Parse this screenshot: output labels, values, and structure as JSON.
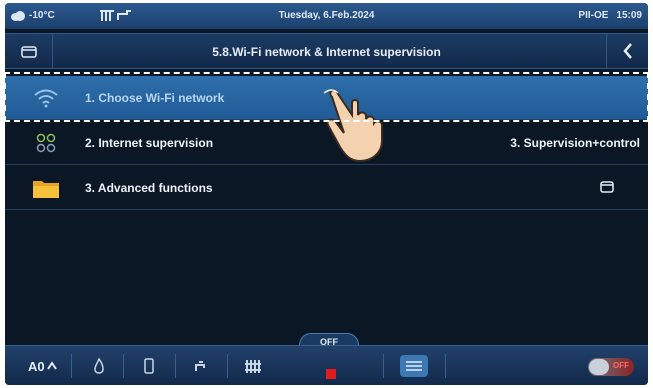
{
  "status": {
    "temperature": "-10°C",
    "date": "Tuesday, 6.Feb.2024",
    "device": "PII-OE",
    "time": "15:09"
  },
  "header": {
    "title": "5.8.Wi-Fi network & Internet supervision",
    "menu_icon": "folder-icon",
    "back_icon": "chevron-left-icon"
  },
  "menu": {
    "items": [
      {
        "label": "1. Choose Wi-Fi network",
        "value": "",
        "icon": "wifi-icon"
      },
      {
        "label": "2. Internet supervision",
        "value": "3. Supervision+control",
        "icon": "dots-grid-icon"
      },
      {
        "label": "3. Advanced functions",
        "value": "",
        "icon": "folder-icon"
      }
    ]
  },
  "bottom": {
    "mode_label": "OFF",
    "toggle_label": "OFF",
    "icons": [
      "heat-mode-icon",
      "flame-icon",
      "boiler-icon",
      "tap-icon",
      "radiator-icon",
      "stop-icon",
      "list-icon",
      "power-toggle"
    ]
  },
  "colors": {
    "accent": "#2f6fab",
    "background": "#0c1725",
    "stop": "#e21c1c"
  }
}
